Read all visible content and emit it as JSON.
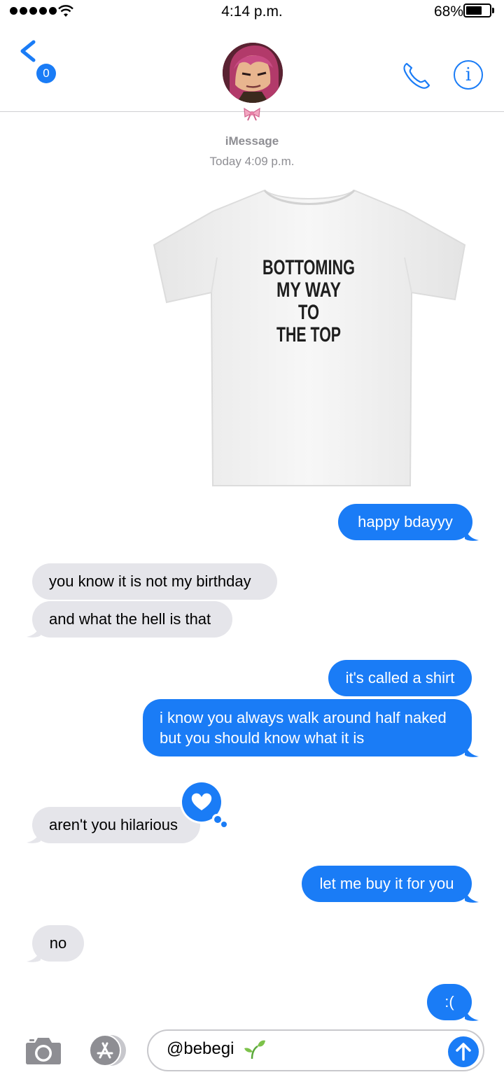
{
  "status_bar": {
    "time": "4:14 p.m.",
    "battery_percent": "68%",
    "battery_level": 0.68,
    "signal_bars": 5
  },
  "header": {
    "back_badge_count": "0",
    "contact_emoji": "bow-icon"
  },
  "thread": {
    "service": "iMessage",
    "timestamp": "Today 4:09 p.m.",
    "attachment": {
      "type": "image",
      "shirt_text": [
        "BOTTOMING",
        "MY WAY",
        "TO",
        "THE TOP"
      ]
    },
    "messages": [
      {
        "dir": "out",
        "text": "happy bdayyy"
      },
      {
        "dir": "in",
        "text": "you know it is not my birthday"
      },
      {
        "dir": "in",
        "text": "and what the hell is that"
      },
      {
        "dir": "out",
        "text": "it's called a shirt"
      },
      {
        "dir": "out",
        "lines": [
          "i know you always walk around half naked",
          "but you should know what it is"
        ]
      },
      {
        "dir": "in",
        "text": "aren't you hilarious",
        "reaction": "heart-icon"
      },
      {
        "dir": "out",
        "text": "let me buy it for you"
      },
      {
        "dir": "in",
        "text": "no"
      },
      {
        "dir": "out",
        "text": ":("
      }
    ]
  },
  "composer": {
    "value": "@bebegi",
    "value_emoji": "sprout-icon"
  },
  "colors": {
    "accent": "#1a7cf6",
    "incoming_bubble": "#e5e5ea",
    "meta_text": "#8e8e93"
  }
}
